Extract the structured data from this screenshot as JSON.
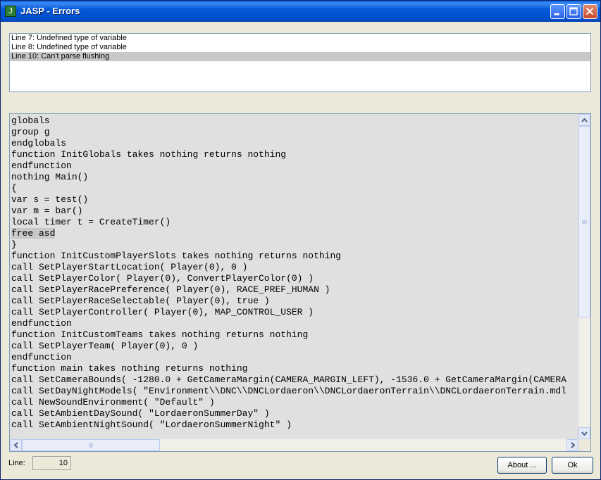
{
  "window": {
    "title": "JASP - Errors",
    "icon": "app-icon"
  },
  "errors": [
    {
      "text": "Line 7: Undefined type of variable"
    },
    {
      "text": "Line 8: Undefined type of variable"
    },
    {
      "text": "Line 10: Can't parse flushing",
      "selected": true
    }
  ],
  "code_lines": [
    "globals",
    "group g",
    "endglobals",
    "function InitGlobals takes nothing returns nothing",
    "endfunction",
    "nothing Main()",
    "{",
    "var s = test()",
    "var m = bar()",
    "local timer t = CreateTimer()",
    "free asd",
    "}",
    "function InitCustomPlayerSlots takes nothing returns nothing",
    "call SetPlayerStartLocation( Player(0), 0 )",
    "call SetPlayerColor( Player(0), ConvertPlayerColor(0) )",
    "call SetPlayerRacePreference( Player(0), RACE_PREF_HUMAN )",
    "call SetPlayerRaceSelectable( Player(0), true )",
    "call SetPlayerController( Player(0), MAP_CONTROL_USER )",
    "endfunction",
    "function InitCustomTeams takes nothing returns nothing",
    "call SetPlayerTeam( Player(0), 0 )",
    "endfunction",
    "function main takes nothing returns nothing",
    "call SetCameraBounds( -1280.0 + GetCameraMargin(CAMERA_MARGIN_LEFT), -1536.0 + GetCameraMargin(CAMERA",
    "call SetDayNightModels( \"Environment\\\\DNC\\\\DNCLordaeron\\\\DNCLordaeronTerrain\\\\DNCLordaeronTerrain.mdl",
    "call NewSoundEnvironment( \"Default\" )",
    "call SetAmbientDaySound( \"LordaeronSummerDay\" )",
    "call SetAmbientNightSound( \"LordaeronSummerNight\" )"
  ],
  "highlighted_line_index": 10,
  "footer": {
    "line_label": "Line:",
    "line_value": "10",
    "about_label": "About ...",
    "ok_label": "Ok"
  }
}
